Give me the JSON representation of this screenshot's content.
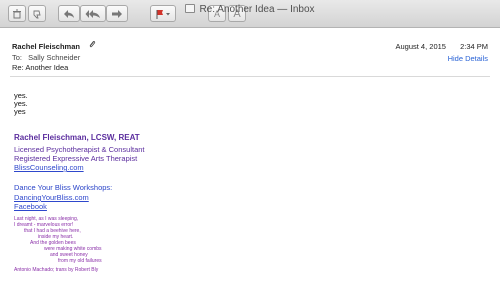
{
  "window": {
    "title": "Re: Another Idea — Inbox"
  },
  "toolbar": {
    "reply_icon": "reply-icon",
    "reply_all_icon": "reply-all-icon",
    "forward_icon": "forward-icon",
    "flag_icon": "flag-icon",
    "text_smaller": "A",
    "text_bigger": "A",
    "flag_color": "#d2342b"
  },
  "message": {
    "sender": "Rachel Fleischman",
    "to_label": "To:",
    "to_value": "Sally Schneider",
    "subject": "Re: Another Idea",
    "date": "August 4, 2015",
    "time": "2:34 PM",
    "hide_details": "Hide Details",
    "body_lines": [
      "yes.",
      "yes.",
      "yes"
    ]
  },
  "signature": {
    "name": "Rachel Fleischman,  LCSW, REAT",
    "title1": "Licensed Psychotherapist & Consultant",
    "title2": "Registered Expressive Arts Therapist",
    "site": "BlissCounseling.com",
    "workshops_label": "Dance Your Bliss Workshops:",
    "workshops_site": "DancingYourBliss.com",
    "facebook": "Facebook",
    "poem": [
      "Last night, as I was sleeping,",
      "I dreamt - marvelous error!",
      "that I had a beehive here,",
      "inside my heart.",
      "And the golden bees",
      "were making white combs",
      "and sweet honey",
      "from my old failures"
    ],
    "poem_credit": "Antonio Machado; trans by Robert Bly"
  }
}
